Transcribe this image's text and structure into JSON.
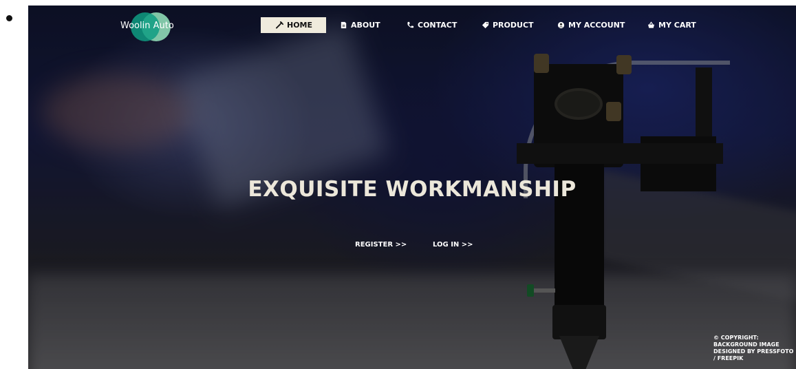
{
  "brand": {
    "name": "Woolin Auto",
    "colors": {
      "primary": "#0f9c83",
      "secondary": "#96e6be",
      "active_nav_bg": "#efebdd"
    }
  },
  "nav": {
    "items": [
      {
        "label": "HOME",
        "icon": "wrench-icon",
        "active": true
      },
      {
        "label": "ABOUT",
        "icon": "document-icon",
        "active": false
      },
      {
        "label": "CONTACT",
        "icon": "phone-icon",
        "active": false
      },
      {
        "label": "PRODUCT",
        "icon": "tag-icon",
        "active": false
      },
      {
        "label": "MY ACCOUNT",
        "icon": "user-icon",
        "active": false
      },
      {
        "label": "MY CART",
        "icon": "basket-icon",
        "active": false
      }
    ]
  },
  "hero": {
    "headline": "EXQUISITE WORKMANSHIP",
    "register_link": "REGISTER >>",
    "login_link": "LOG IN >>",
    "credit": "© COPYRIGHT: BACKGROUND IMAGE DESIGNED BY PRESSFOTO / FREEPIK"
  }
}
